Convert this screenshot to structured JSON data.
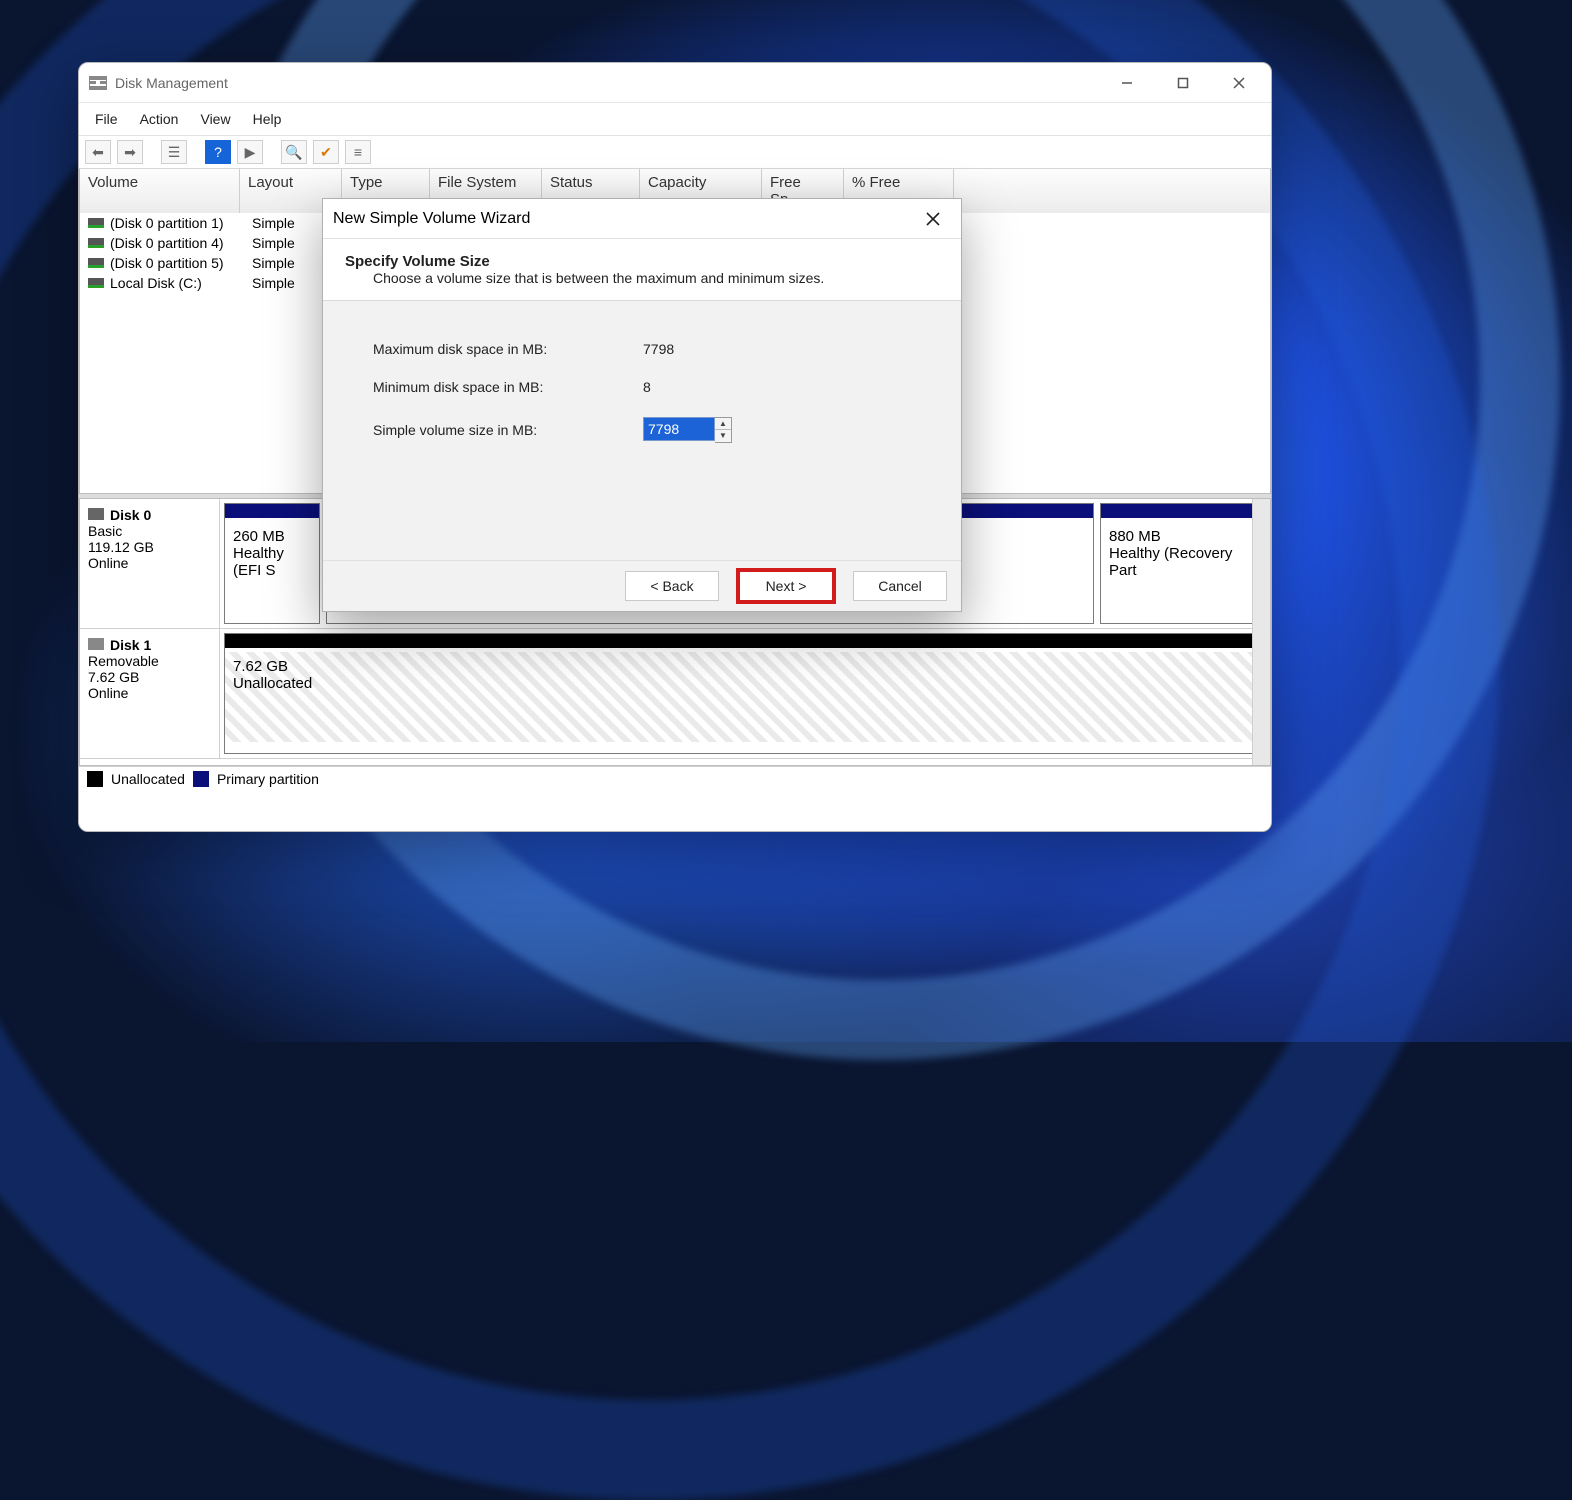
{
  "app": {
    "title": "Disk Management"
  },
  "menu": {
    "file": "File",
    "action": "Action",
    "view": "View",
    "help": "Help"
  },
  "toolbar_icons": {
    "back": "back-arrow-icon",
    "fwd": "forward-arrow-icon",
    "list": "list-icon",
    "help": "help-icon",
    "run": "run-icon",
    "search": "search-icon",
    "check": "check-icon",
    "props": "properties-icon"
  },
  "columns": {
    "volume": "Volume",
    "layout": "Layout",
    "type": "Type",
    "fs": "File System",
    "status": "Status",
    "capacity": "Capacity",
    "free": "Free Sp…",
    "pct": "% Free"
  },
  "volumes": [
    {
      "name": "(Disk 0 partition 1)",
      "layout": "Simple"
    },
    {
      "name": "(Disk 0 partition 4)",
      "layout": "Simple"
    },
    {
      "name": "(Disk 0 partition 5)",
      "layout": "Simple"
    },
    {
      "name": "Local Disk (C:)",
      "layout": "Simple"
    }
  ],
  "disk0": {
    "title": "Disk 0",
    "kind": "Basic",
    "size": "119.12 GB",
    "state": "Online",
    "partA_size": "260 MB",
    "partA_status": "Healthy (EFI S",
    "partB_size": "880 MB",
    "partB_status": "Healthy (Recovery Part"
  },
  "disk1": {
    "title": "Disk 1",
    "kind": "Removable",
    "size": "7.62 GB",
    "state": "Online",
    "part_size": "7.62 GB",
    "part_status": "Unallocated"
  },
  "legend": {
    "unalloc": "Unallocated",
    "primary": "Primary partition"
  },
  "wizard": {
    "title": "New Simple Volume Wizard",
    "heading": "Specify Volume Size",
    "sub": "Choose a volume size that is between the maximum and minimum sizes.",
    "max_label": "Maximum disk space in MB:",
    "max_val": "7798",
    "min_label": "Minimum disk space in MB:",
    "min_val": "8",
    "size_label": "Simple volume size in MB:",
    "size_val": "7798",
    "back": "< Back",
    "next": "Next >",
    "cancel": "Cancel"
  }
}
